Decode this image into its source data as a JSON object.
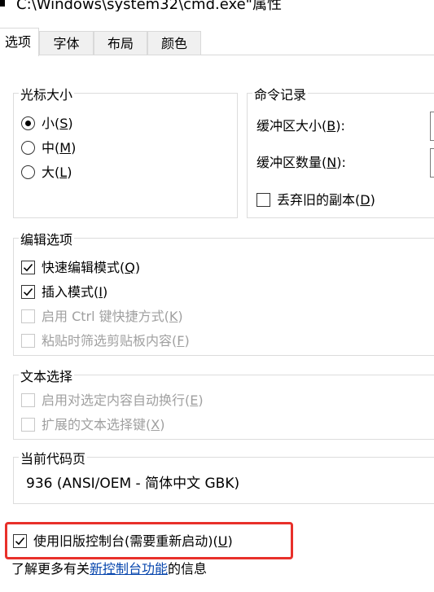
{
  "window": {
    "title": "C:\\Windows\\system32\\cmd.exe\"属性"
  },
  "tabs": [
    {
      "label": "选项",
      "active": true
    },
    {
      "label": "字体",
      "active": false
    },
    {
      "label": "布局",
      "active": false
    },
    {
      "label": "颜色",
      "active": false
    }
  ],
  "cursor_size": {
    "legend": "光标大小",
    "options": [
      {
        "label": "小",
        "accel": "S",
        "selected": true
      },
      {
        "label": "中",
        "accel": "M",
        "selected": false
      },
      {
        "label": "大",
        "accel": "L",
        "selected": false
      }
    ]
  },
  "command_history": {
    "legend": "命令记录",
    "buffer_size_label": "缓冲区大小",
    "buffer_size_accel": "B",
    "buffer_count_label": "缓冲区数量",
    "buffer_count_accel": "N",
    "discard_label": "丢弃旧的副本",
    "discard_accel": "D",
    "discard_checked": false
  },
  "edit_options": {
    "legend": "编辑选项",
    "quick_edit_label": "快速编辑模式",
    "quick_edit_accel": "Q",
    "insert_label": "插入模式",
    "insert_accel": "I",
    "ctrl_label": "启用 Ctrl 键快捷方式",
    "ctrl_accel": "K",
    "filter_label": "粘贴时筛选剪贴板内容",
    "filter_accel": "F"
  },
  "text_selection": {
    "legend": "文本选择",
    "wrap_label": "启用对选定内容自动换行",
    "wrap_accel": "E",
    "extended_label": "扩展的文本选择键",
    "extended_accel": "X"
  },
  "codepage": {
    "legend": "当前代码页",
    "value": "936   (ANSI/OEM - 简体中文 GBK)"
  },
  "legacy": {
    "label": "使用旧版控制台(需要重新启动)",
    "accel": "U",
    "checked": true
  },
  "learn_more": {
    "prefix": "了解更多有关",
    "link": "新控制台功能",
    "suffix": "的信息"
  },
  "colors": {
    "highlight": "#e8302a",
    "link": "#0645ad",
    "disabled": "#a0a0a0"
  }
}
